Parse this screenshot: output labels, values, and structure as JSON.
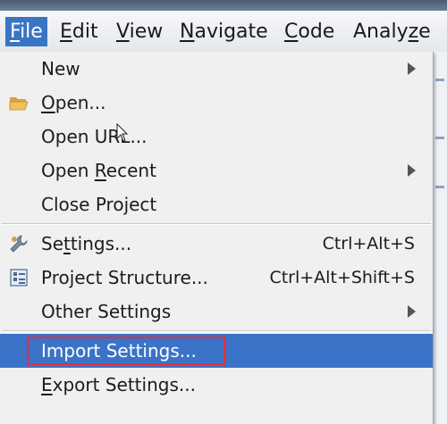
{
  "menubar": {
    "items": [
      {
        "pre": "",
        "mn": "F",
        "post": "ile"
      },
      {
        "pre": "",
        "mn": "E",
        "post": "dit"
      },
      {
        "pre": "",
        "mn": "V",
        "post": "iew"
      },
      {
        "pre": "",
        "mn": "N",
        "post": "avigate"
      },
      {
        "pre": "",
        "mn": "C",
        "post": "ode"
      },
      {
        "pre": "Analy",
        "mn": "z",
        "post": "e"
      }
    ]
  },
  "file_menu": {
    "new": {
      "label": "New"
    },
    "open": {
      "mn": "O",
      "rest": "pen..."
    },
    "open_url": {
      "label": "Open URL..."
    },
    "open_recent": {
      "pre": "Open ",
      "mn": "R",
      "post": "ecent"
    },
    "close_project": {
      "label": "Close Project"
    },
    "settings": {
      "pre": "Se",
      "mn": "t",
      "post": "tings...",
      "shortcut": "Ctrl+Alt+S"
    },
    "project_structure": {
      "label": "Project Structure...",
      "shortcut": "Ctrl+Alt+Shift+S"
    },
    "other_settings": {
      "label": "Other Settings"
    },
    "import_settings": {
      "label": "Import Settings..."
    },
    "export_settings": {
      "mn": "E",
      "rest": "xport Settings..."
    }
  },
  "colors": {
    "highlight": "#3b73c8",
    "callout_border": "#e0303a",
    "menu_background": "#f0f0f0"
  },
  "icons": [
    "folder-open-icon",
    "wrench-icon",
    "project-structure-icon",
    "submenu-arrow-icon",
    "mouse-cursor-icon"
  ]
}
